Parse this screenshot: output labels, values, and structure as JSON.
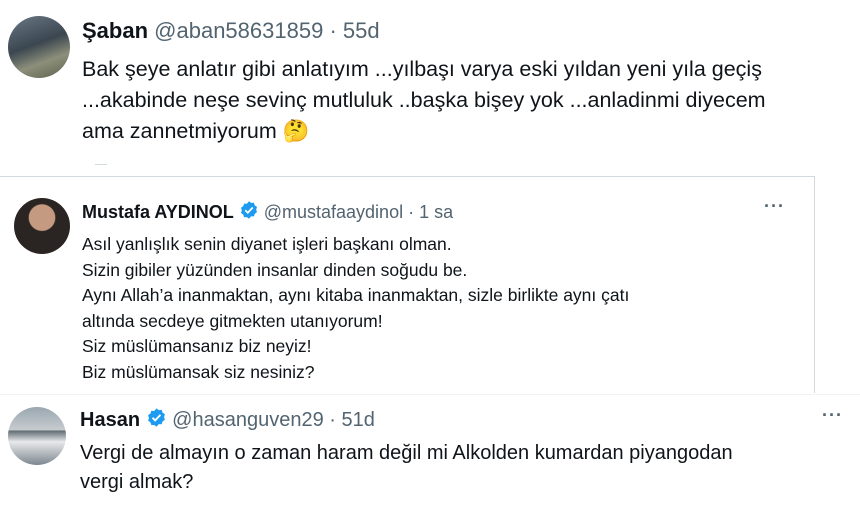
{
  "tweets": [
    {
      "name": "Şaban",
      "handle": "@aban58631859",
      "dot": "·",
      "time": "55d",
      "text": "Bak şeye anlatır gibi anlatıyım ...yılbaşı varya eski yıldan yeni yıla geçiş\n...akabinde neşe sevinç mutluluk ..başka bişey yok ...anladinmi diyecem\nama zannetmiyorum",
      "emoji": "🤔",
      "verified": false
    },
    {
      "name": "Mustafa AYDINOL",
      "handle": "@mustafaaydinol",
      "dot": "·",
      "time": "1 sa",
      "text": "Asıl yanlışlık senin diyanet işleri başkanı olman.\nSizin gibiler yüzünden insanlar dinden soğudu be.\nAynı Allah’a inanmaktan, aynı kitaba inanmaktan, sizle birlikte aynı çatı\naltında secdeye gitmekten utanıyorum!\nSiz müslümansanız biz neyiz!\nBiz müslümansak siz nesiniz?",
      "verified": true,
      "more": "···"
    },
    {
      "name": "Hasan",
      "handle": "@hasanguven29",
      "dot": "·",
      "time": "51d",
      "text": "Vergi de almayın o zaman haram değil mi Alkolden kumardan piyangodan\nvergi almak?",
      "verified": true,
      "more": "···"
    }
  ],
  "colors": {
    "verified": "#1d9bf0",
    "secondary_text": "#536471",
    "border": "#cfd9de"
  },
  "icons": {
    "verified": "verified-badge-icon",
    "more": "more-options-icon"
  }
}
